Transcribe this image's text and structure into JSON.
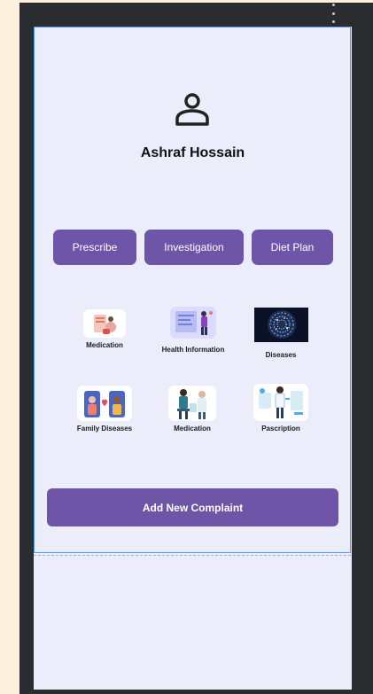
{
  "profile": {
    "name": "Ashraf Hossain"
  },
  "actions": {
    "prescribe": "Prescribe",
    "investigation": "Investigation",
    "diet_plan": "Diet Plan"
  },
  "tiles": [
    {
      "label": "Medication",
      "icon": "medication-illustration"
    },
    {
      "label": "Health Information",
      "icon": "health-information-illustration"
    },
    {
      "label": "Diseases",
      "icon": "diseases-illustration"
    },
    {
      "label": "Family Diseases",
      "icon": "family-diseases-illustration"
    },
    {
      "label": "Medication",
      "icon": "medication-doctor-illustration"
    },
    {
      "label": "Pascription",
      "icon": "prescription-illustration"
    }
  ],
  "add_complaint": "Add New Complaint",
  "colors": {
    "accent": "#6f55a8",
    "screen": "#ecedfb",
    "page": "#fdf1dd",
    "frame": "#2b2c2f"
  }
}
